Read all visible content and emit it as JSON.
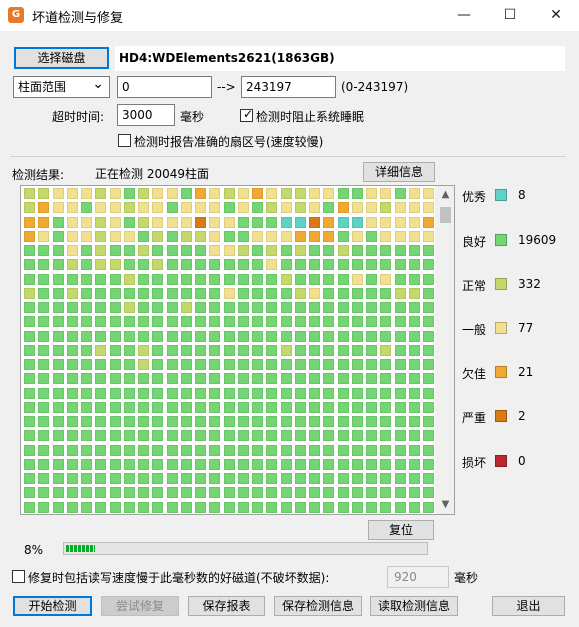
{
  "window": {
    "title": "坏道检测与修复",
    "minimize": "—",
    "maximize": "☐",
    "close": "✕"
  },
  "disk": {
    "select_button": "选择磁盘",
    "name": "HD4:WDElements2621(1863GB)"
  },
  "range": {
    "mode": "柱面范围",
    "start": "0",
    "arrow": "-->",
    "end": "243197",
    "hint": "(0-243197)"
  },
  "timeout": {
    "label": "超时时间:",
    "value": "3000",
    "unit": "毫秒"
  },
  "options": {
    "prevent_sleep_label": "检测时阻止系统睡眠",
    "prevent_sleep_checked": true,
    "report_sector_label": "检测时报告准确的扇区号(速度较慢)",
    "report_sector_checked": false
  },
  "result": {
    "label": "检测结果:",
    "status": "正在检测 20049柱面",
    "detail_button": "详细信息"
  },
  "legend": [
    {
      "label": "优秀",
      "count": "8",
      "color": "#5fd3c3"
    },
    {
      "label": "良好",
      "count": "19609",
      "color": "#73d672"
    },
    {
      "label": "正常",
      "count": "332",
      "color": "#c3d96a"
    },
    {
      "label": "一般",
      "count": "77",
      "color": "#f1e08e"
    },
    {
      "label": "欠佳",
      "count": "21",
      "color": "#f0aa32"
    },
    {
      "label": "严重",
      "count": "2",
      "color": "#d97a18"
    },
    {
      "label": "损坏",
      "count": "0",
      "color": "#b8282f"
    }
  ],
  "reset_button": "复位",
  "progress": {
    "text": "8%",
    "value": 0.08
  },
  "repair_option": {
    "label": "修复时包括读写速度慢于此毫秒数的好磁道(不破坏数据):",
    "checked": false,
    "value": "920",
    "unit": "毫秒"
  },
  "actions": {
    "start": "开始检测",
    "try_repair": "尝试修复",
    "save_report": "保存报表",
    "save_info": "保存检测信息",
    "load_info": "读取检测信息",
    "exit": "退出"
  },
  "icons": {
    "app": "disk-repair-icon",
    "scroll_up": "▲",
    "scroll_down": "▼",
    "dropdown": "⌄"
  }
}
